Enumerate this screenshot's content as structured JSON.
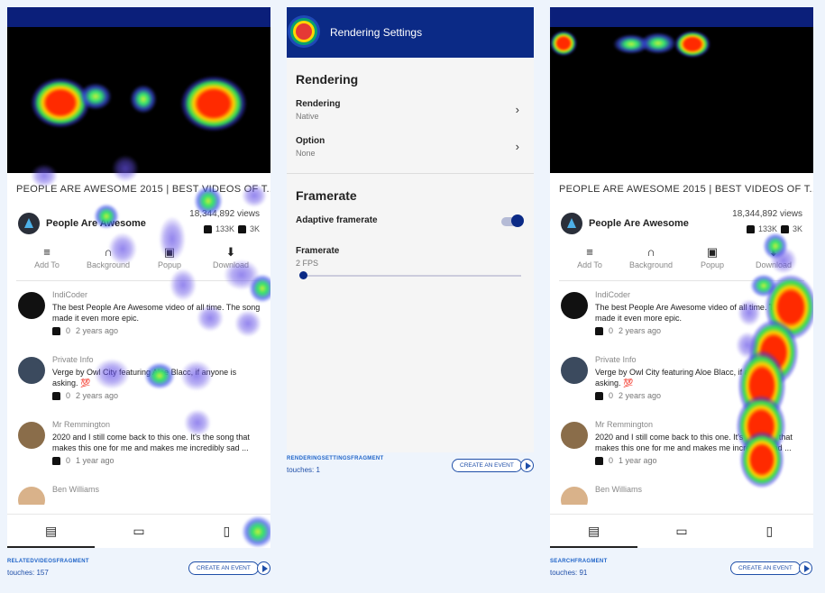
{
  "panels": [
    {
      "video_title": "PEOPLE ARE AWESOME 2015 | BEST VIDEOS OF T...",
      "channel_name": "People Are Awesome",
      "views": "18,344,892 views",
      "likes": "133K",
      "dislikes": "3K",
      "actions": [
        "Add To",
        "Background",
        "Popup",
        "Download"
      ],
      "comments": [
        {
          "user": "IndiCoder",
          "text": "The best People Are Awesome video of all time. The song made it even more epic.",
          "likes": "0",
          "time": "2 years ago"
        },
        {
          "user": "Private Info",
          "text": "Verge by Owl City featuring Aloe Blacc, if anyone is asking. 💯",
          "likes": "0",
          "time": "2 years ago"
        },
        {
          "user": "Mr Remmington",
          "text": "2020 and I still come back to this one. It's the song that makes this one for me and makes me incredibly sad ...",
          "likes": "0",
          "time": "1 year ago"
        },
        {
          "user": "Ben Williams",
          "text": "",
          "likes": "",
          "time": ""
        }
      ],
      "fragment": "RELATEDVIDEOSFRAGMENT",
      "touches": "touches: 157",
      "create_event": "CREATE AN EVENT"
    },
    {
      "header_title": "Rendering Settings",
      "section_rendering": "Rendering",
      "rows_rendering": [
        {
          "label": "Rendering",
          "value": "Native"
        },
        {
          "label": "Option",
          "value": "None"
        }
      ],
      "section_framerate": "Framerate",
      "adaptive_label": "Adaptive framerate",
      "adaptive_on": true,
      "framerate_label": "Framerate",
      "framerate_value": "2 FPS",
      "fragment": "RENDERINGSETTINGSFRAGMENT",
      "touches": "touches: 1",
      "create_event": "CREATE AN EVENT"
    },
    {
      "video_title": "PEOPLE ARE AWESOME 2015 | BEST VIDEOS OF T...",
      "channel_name": "People Are Awesome",
      "views": "18,344,892 views",
      "likes": "133K",
      "dislikes": "3K",
      "actions": [
        "Add To",
        "Background",
        "Popup",
        "Download"
      ],
      "comments": [
        {
          "user": "IndiCoder",
          "text": "The best People Are Awesome video of all time. The song made it even more epic.",
          "likes": "0",
          "time": "2 years ago"
        },
        {
          "user": "Private Info",
          "text": "Verge by Owl City featuring Aloe Blacc, if anyone is asking. 💯",
          "likes": "0",
          "time": "2 years ago"
        },
        {
          "user": "Mr Remmington",
          "text": "2020 and I still come back to this one. It's the song that makes this one for me and makes me incredibly sad ...",
          "likes": "0",
          "time": "1 year ago"
        },
        {
          "user": "Ben Williams",
          "text": "",
          "likes": "",
          "time": ""
        }
      ],
      "fragment": "SEARCHFRAGMENT",
      "touches": "touches: 91",
      "create_event": "CREATE AN EVENT"
    }
  ],
  "colors": {
    "app_bar": "#0b1f7a",
    "accent": "#1e4ea8",
    "heat_hot": "#ff2a00",
    "heat_warm": "#33e070",
    "heat_cool": "#6450e6"
  },
  "icons": {
    "add_to": "playlist-add-icon",
    "background": "headphones-icon",
    "popup": "picture-in-picture-icon",
    "download": "download-icon",
    "like": "thumb-up-icon",
    "dislike": "thumb-down-icon",
    "chevron": "chevron-right-icon",
    "play": "play-icon"
  }
}
